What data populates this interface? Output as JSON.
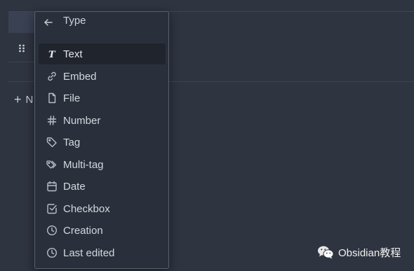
{
  "background": {
    "new_property_label": "N"
  },
  "menu": {
    "title": "Type",
    "items": [
      {
        "label": "Text",
        "icon": "text-type-icon",
        "active": true
      },
      {
        "label": "Embed",
        "icon": "link-icon",
        "active": false
      },
      {
        "label": "File",
        "icon": "file-icon",
        "active": false
      },
      {
        "label": "Number",
        "icon": "hash-icon",
        "active": false
      },
      {
        "label": "Tag",
        "icon": "tag-icon",
        "active": false
      },
      {
        "label": "Multi-tag",
        "icon": "tags-icon",
        "active": false
      },
      {
        "label": "Date",
        "icon": "calendar-icon",
        "active": false
      },
      {
        "label": "Checkbox",
        "icon": "checkbox-icon",
        "active": false
      },
      {
        "label": "Creation",
        "icon": "clock-icon",
        "active": false
      },
      {
        "label": "Last edited",
        "icon": "clock-icon",
        "active": false
      }
    ]
  },
  "watermark": {
    "text": "Obsidian教程",
    "logo": "wechat-logo"
  },
  "colors": {
    "background": "#2e3440",
    "menu_background": "#2a303b",
    "menu_border": "#5a606c",
    "active_item": "#20242c",
    "text": "#d3d7df"
  }
}
